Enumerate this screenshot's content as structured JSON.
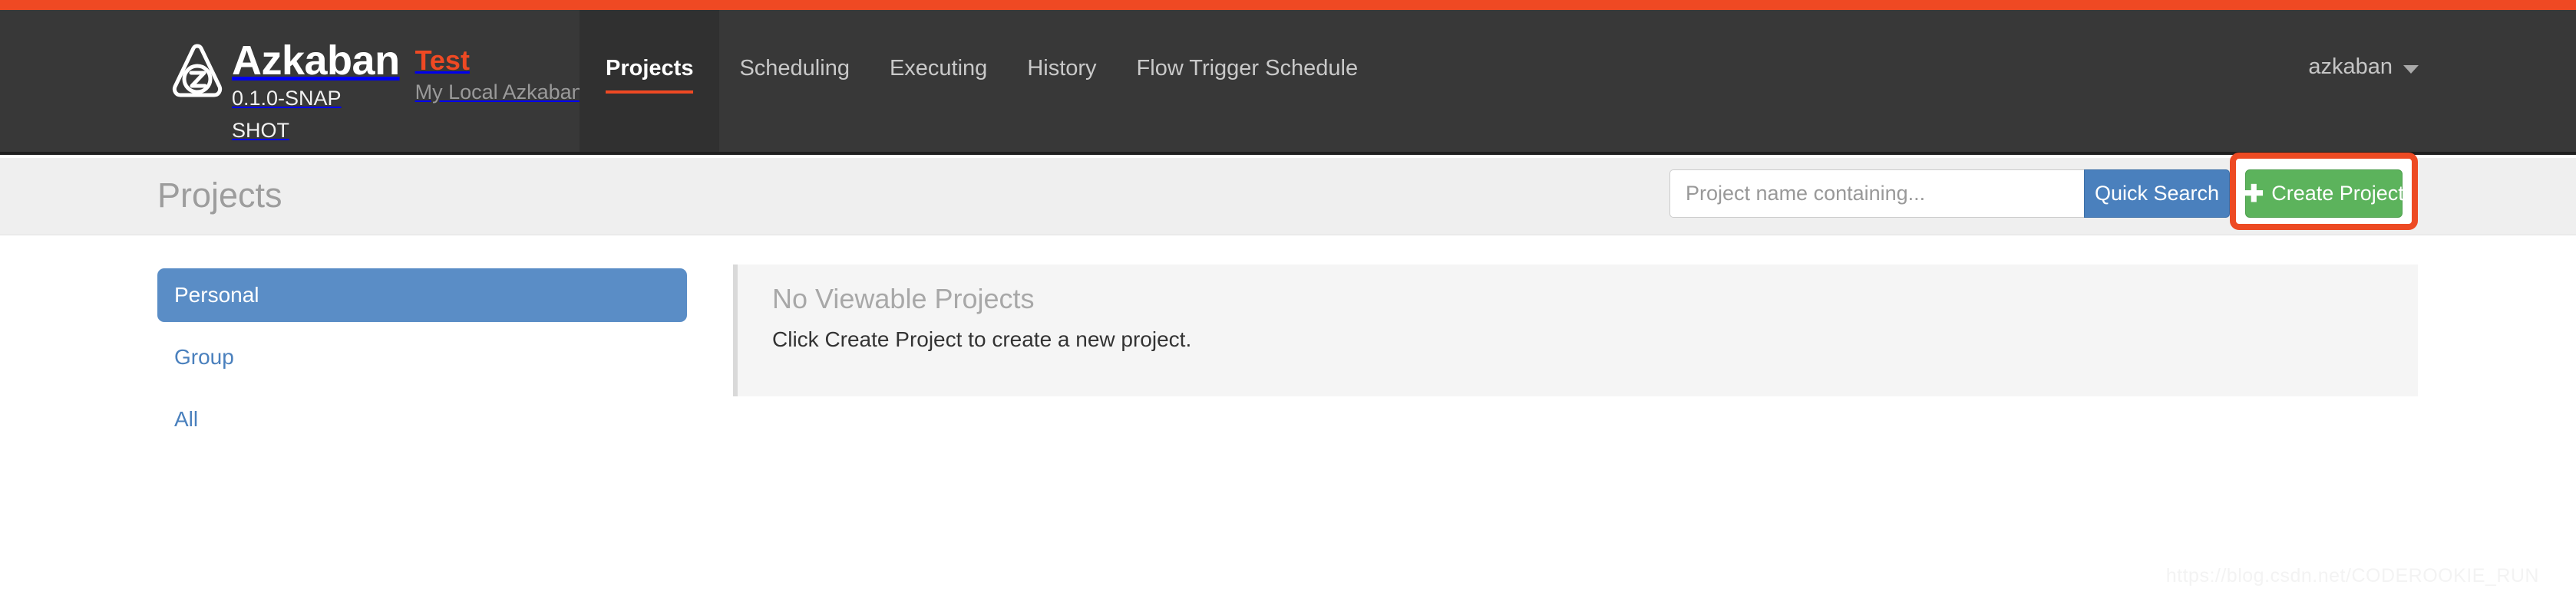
{
  "colors": {
    "accent_orange": "#ef4923",
    "navbar_dark": "#383838",
    "tab_active_bg": "#303030",
    "subheader_bg": "#efefef",
    "link_blue": "#4a80bd",
    "sidebar_active_blue": "#5a8dc6",
    "button_green": "#5cb35c",
    "annotation_red": "#ed4a23",
    "panel_bg": "#f5f5f5",
    "panel_border": "#d9d9d9"
  },
  "navbar": {
    "logo_icon": "azkaban-triangle-z-logo",
    "brand_name": "Azkaban",
    "brand_version": "0.1.0-SNAPSHOT",
    "environment_label": "Test",
    "tagline": "My Local Azkaban",
    "tabs": [
      {
        "label": "Projects",
        "active": true
      },
      {
        "label": "Scheduling",
        "active": false
      },
      {
        "label": "Executing",
        "active": false
      },
      {
        "label": "History",
        "active": false
      },
      {
        "label": "Flow Trigger Schedule",
        "active": false
      }
    ],
    "user": {
      "name": "azkaban",
      "caret_icon": "chevron-down-icon"
    }
  },
  "subheader": {
    "page_title": "Projects",
    "search": {
      "placeholder": "Project name containing...",
      "value": "",
      "button_label": "Quick Search"
    },
    "create_project": {
      "plus_icon": "plus-icon",
      "label": "Create Project"
    }
  },
  "sidebar": {
    "items": [
      {
        "label": "Personal",
        "active": true
      },
      {
        "label": "Group",
        "active": false
      },
      {
        "label": "All",
        "active": false
      }
    ]
  },
  "main": {
    "empty_state": {
      "heading": "No Viewable Projects",
      "description": "Click Create Project to create a new project."
    }
  },
  "watermark": {
    "text": "https://blog.csdn.net/CODEROOKIE_RUN"
  }
}
